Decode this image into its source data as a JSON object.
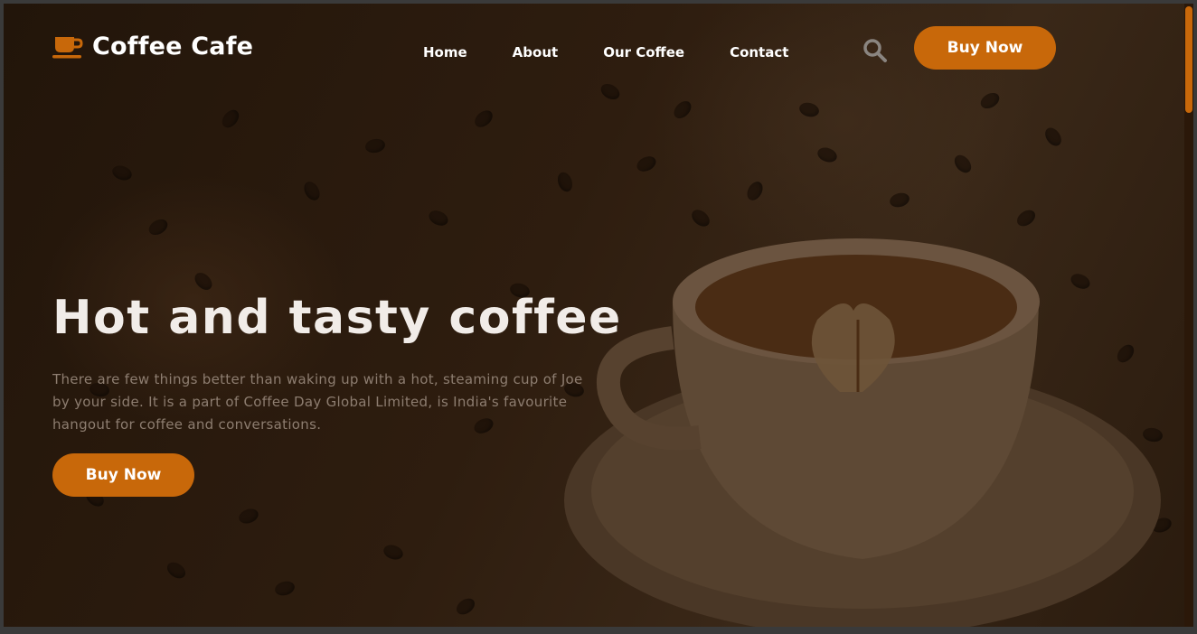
{
  "brand": {
    "name": "Coffee Cafe",
    "icon": "coffee-cup-icon",
    "accent_color": "#c8680a"
  },
  "nav": {
    "items": [
      {
        "label": "Home"
      },
      {
        "label": "About"
      },
      {
        "label": "Our Coffee"
      },
      {
        "label": "Contact"
      }
    ],
    "search_icon": "search-icon",
    "cta_label": "Buy Now"
  },
  "hero": {
    "title": "Hot and tasty coffee",
    "description": "There are few things better than waking up with a hot, steaming cup of Joe by your side. It is a part of Coffee Day Global Limited, is India's favourite hangout for coffee and conversations.",
    "cta_label": "Buy Now"
  },
  "scrollbar": {
    "position_fraction": 0
  }
}
